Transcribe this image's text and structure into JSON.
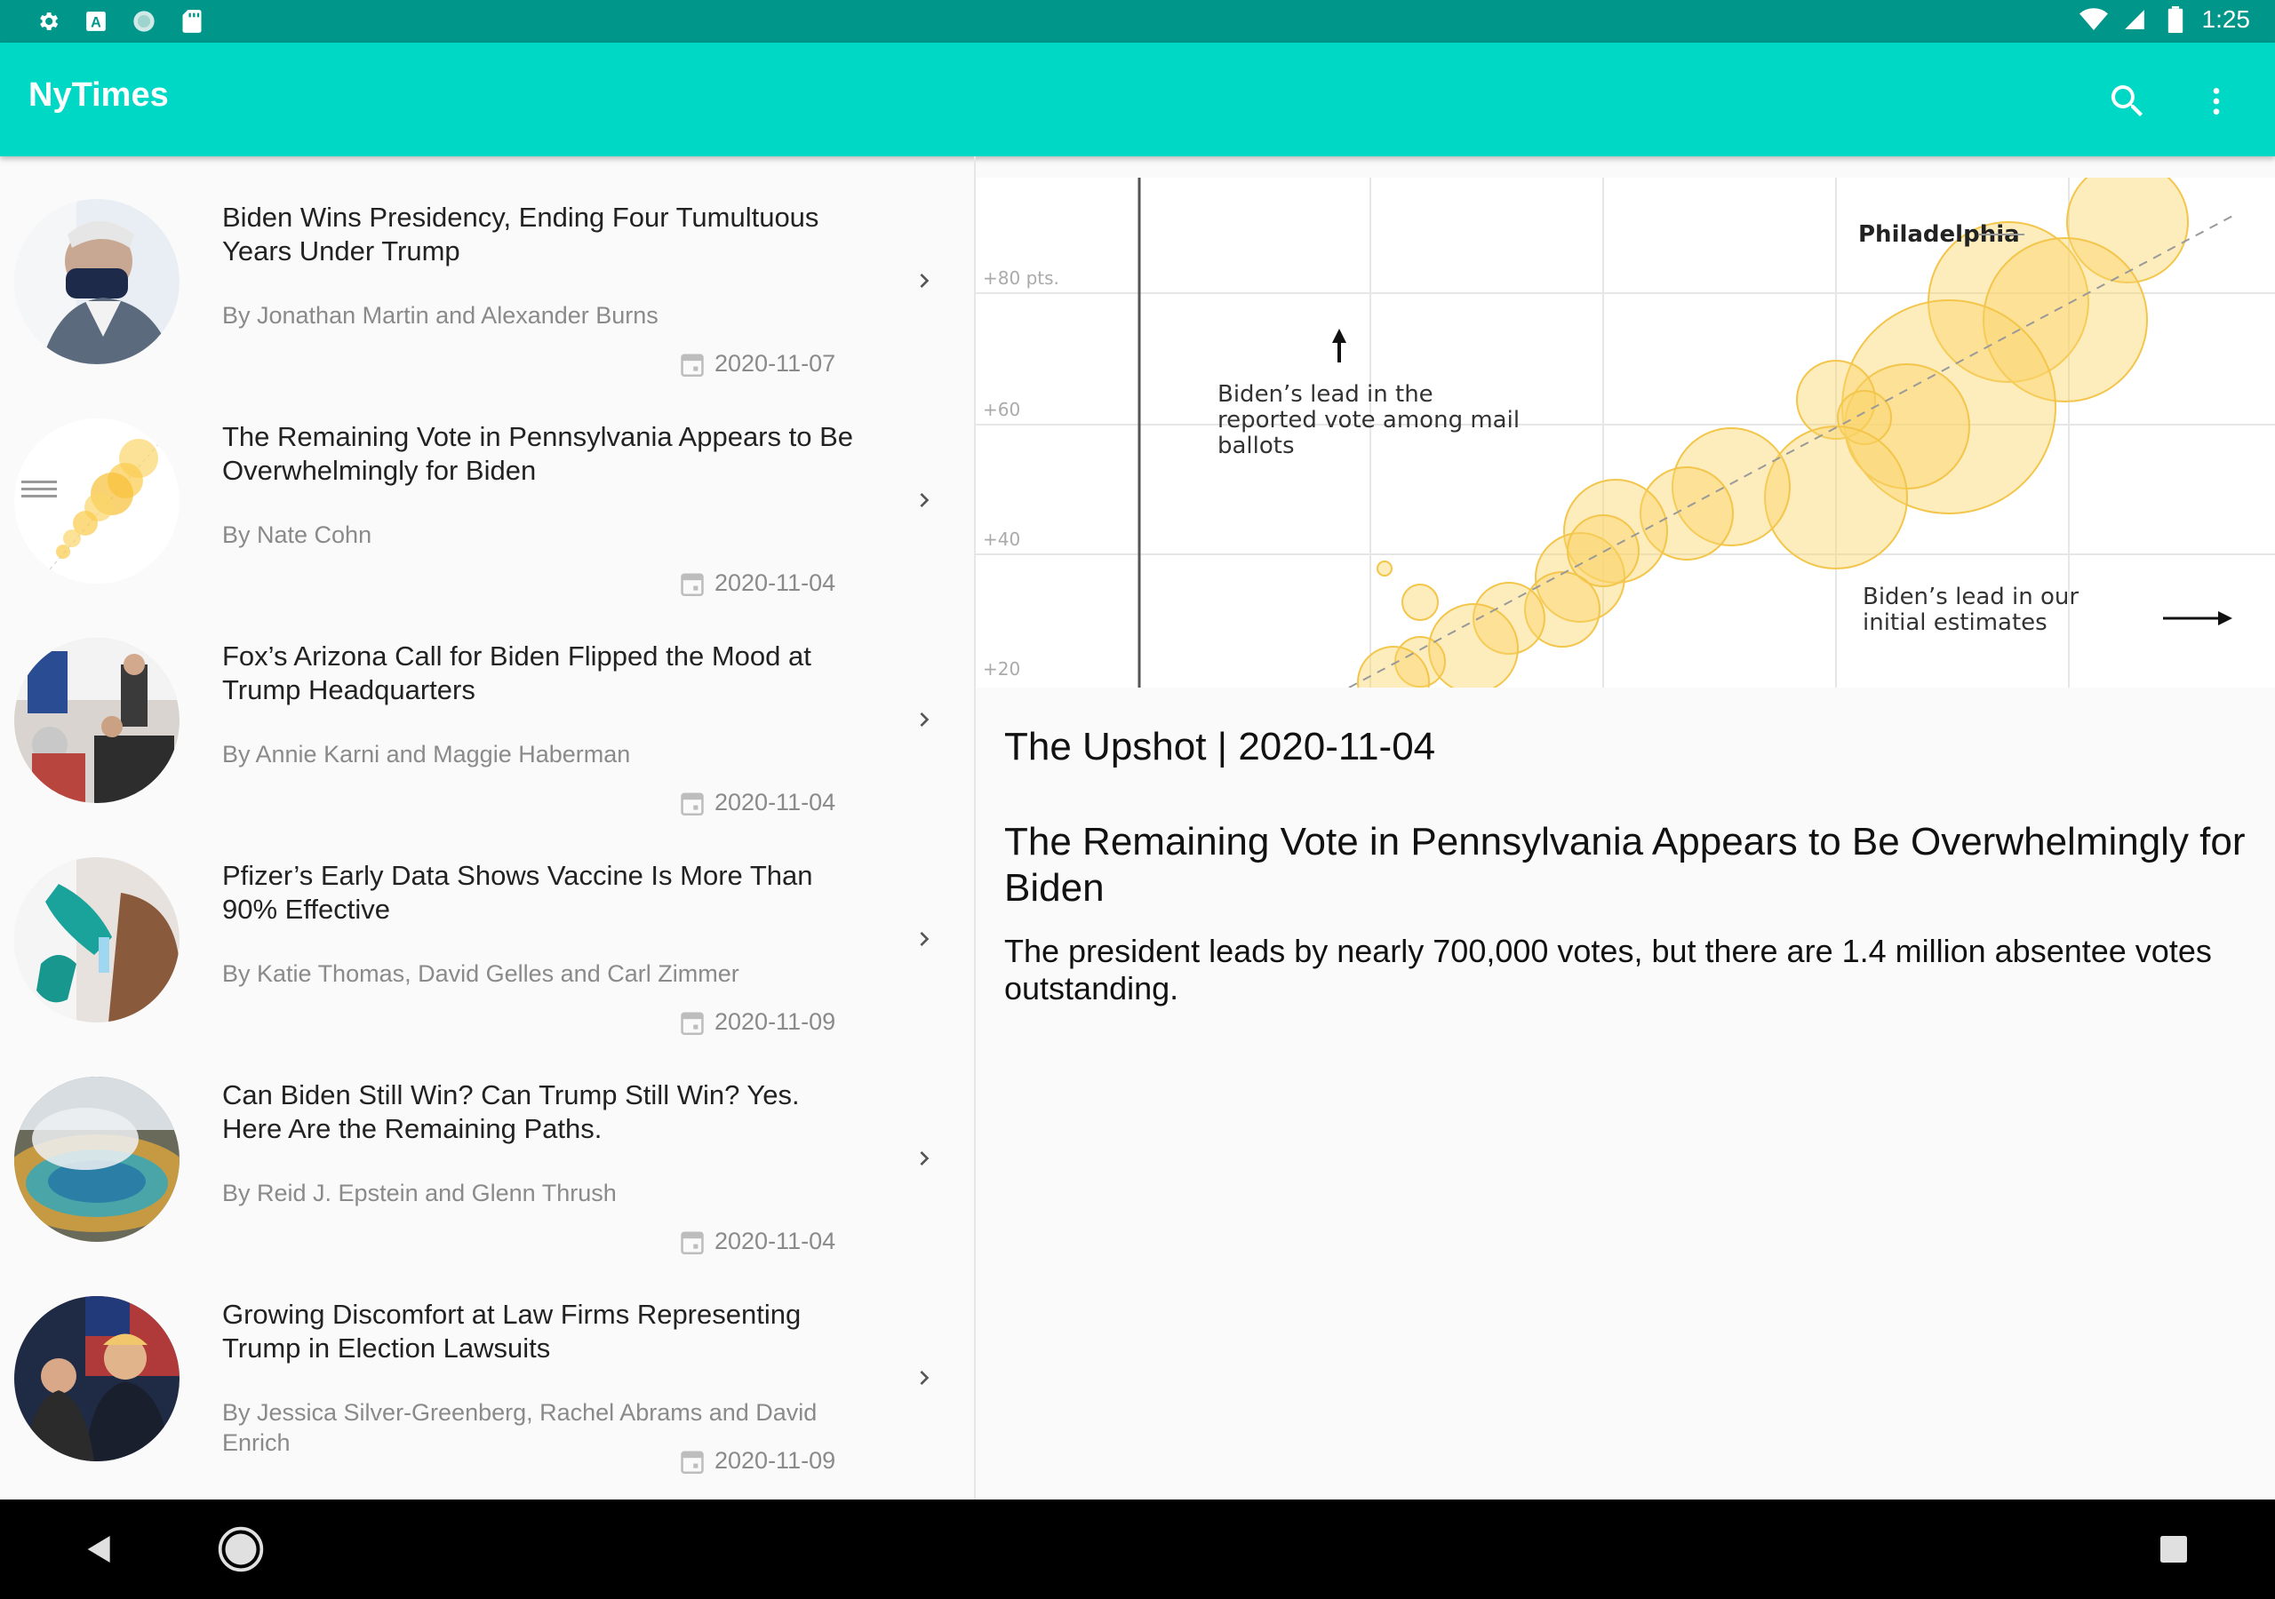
{
  "status_bar": {
    "time": "1:25",
    "left_icons": [
      "gear-icon",
      "a-badge-icon",
      "circle-icon",
      "sd-card-icon"
    ],
    "right_icons": [
      "wifi-icon",
      "signal-icon",
      "battery-icon"
    ]
  },
  "toolbar": {
    "title": "NyTimes",
    "bg_color": "#00d8c6",
    "actions": [
      "search-icon",
      "more-vert-icon"
    ]
  },
  "articles": [
    {
      "title": "Biden Wins Presidency, Ending Four Tumultuous Years Under Trump",
      "byline": "By Jonathan Martin and Alexander Burns",
      "date": "2020-11-07"
    },
    {
      "title": "The Remaining Vote in Pennsylvania Appears to Be Overwhelmingly for Biden",
      "byline": "By Nate Cohn",
      "date": "2020-11-04"
    },
    {
      "title": "Fox’s Arizona Call for Biden Flipped the Mood at Trump Headquarters",
      "byline": "By Annie Karni and Maggie Haberman",
      "date": "2020-11-04"
    },
    {
      "title": "Pfizer’s Early Data Shows Vaccine Is More Than 90% Effective",
      "byline": "By Katie Thomas, David Gelles and Carl Zimmer",
      "date": "2020-11-09"
    },
    {
      "title": "Can Biden Still Win? Can Trump Still Win? Yes. Here Are the Remaining Paths.",
      "byline": "By Reid J. Epstein and Glenn Thrush",
      "date": "2020-11-04"
    },
    {
      "title": "Growing Discomfort at Law Firms Representing Trump in Election Lawsuits",
      "byline": "By Jessica Silver-Greenberg, Rachel Abrams and David Enrich",
      "date": "2020-11-09"
    }
  ],
  "detail": {
    "meta": "The Upshot | 2020-11-04",
    "title": "The Remaining Vote in Pennsylvania Appears to Be Overwhelmingly for Biden",
    "abstract": "The president leads by nearly 700,000 votes, but there are 1.4 million absentee votes outstanding.",
    "hero_image": {
      "label_city": "Philadelphia",
      "label_y": "Biden’s lead in the reported vote among mail ballots",
      "label_x": "Biden’s lead in our initial estimates",
      "y_ticks": [
        "+80 pts.",
        "+60",
        "+40",
        "+20"
      ]
    }
  },
  "nav": [
    "back-icon",
    "home-icon",
    "recents-icon"
  ]
}
